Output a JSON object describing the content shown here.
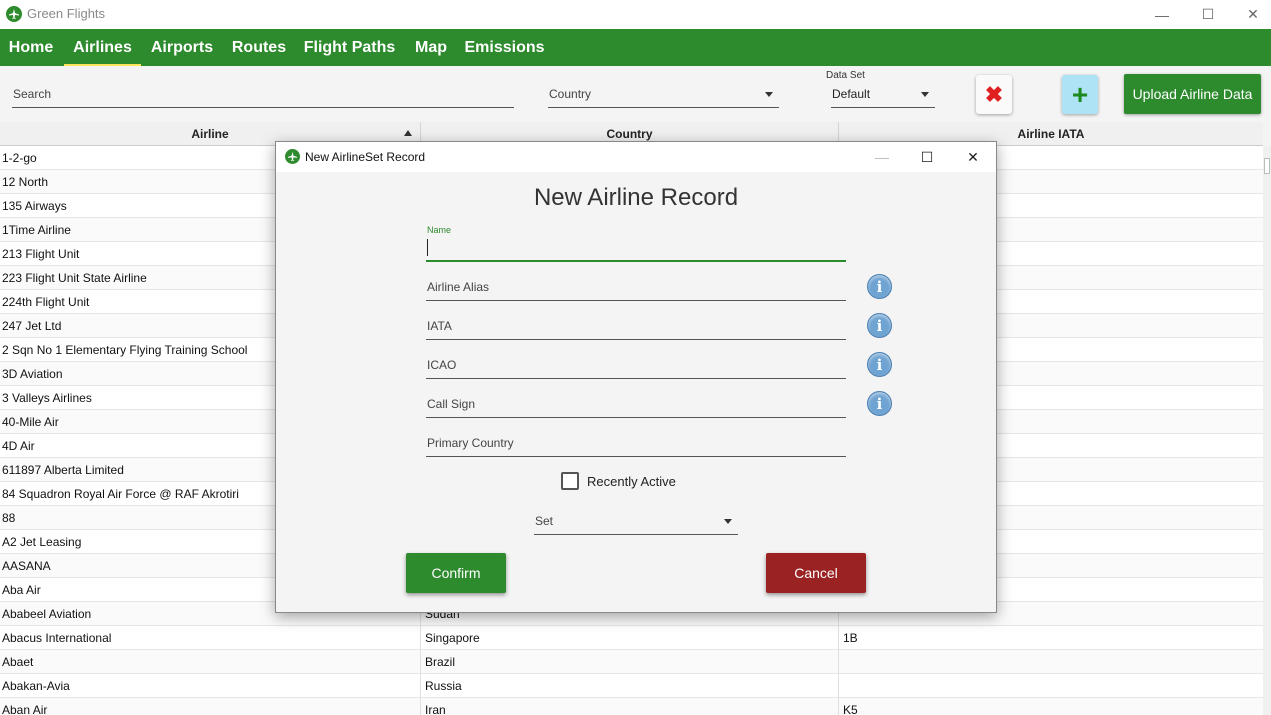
{
  "window": {
    "title": "Green Flights",
    "minimize": "—",
    "maximize": "☐",
    "close": "✕"
  },
  "nav": {
    "items": [
      {
        "label": "Home"
      },
      {
        "label": "Airlines",
        "active": true
      },
      {
        "label": "Airports"
      },
      {
        "label": "Routes"
      },
      {
        "label": "Flight Paths"
      },
      {
        "label": "Map"
      },
      {
        "label": "Emissions"
      }
    ]
  },
  "toolbar": {
    "search_label": "Search",
    "country_label": "Country",
    "dataset_label": "Data Set",
    "dataset_value": "Default",
    "delete_glyph": "✖",
    "add_glyph": "+",
    "upload_label": "Upload Airline Data"
  },
  "table": {
    "columns": [
      "Airline",
      "Country",
      "Airline IATA"
    ],
    "rows": [
      [
        "1-2-go",
        "",
        ""
      ],
      [
        "12 North",
        "",
        ""
      ],
      [
        "135 Airways",
        "",
        ""
      ],
      [
        "1Time Airline",
        "",
        ""
      ],
      [
        "213 Flight Unit",
        "",
        ""
      ],
      [
        "223 Flight Unit State Airline",
        "",
        ""
      ],
      [
        "224th Flight Unit",
        "",
        ""
      ],
      [
        "247 Jet Ltd",
        "",
        ""
      ],
      [
        "2 Sqn No 1 Elementary Flying Training School",
        "",
        ""
      ],
      [
        "3D Aviation",
        "",
        ""
      ],
      [
        "3 Valleys Airlines",
        "",
        ""
      ],
      [
        "40-Mile Air",
        "",
        ""
      ],
      [
        "4D Air",
        "",
        ""
      ],
      [
        "611897 Alberta Limited",
        "",
        ""
      ],
      [
        "84 Squadron Royal Air Force @ RAF Akrotiri",
        "",
        ""
      ],
      [
        "88",
        "",
        ""
      ],
      [
        "A2 Jet Leasing",
        "",
        ""
      ],
      [
        "AASANA",
        "",
        ""
      ],
      [
        "Aba Air",
        "",
        ""
      ],
      [
        "Ababeel Aviation",
        "Sudan",
        ""
      ],
      [
        "Abacus International",
        "Singapore",
        "1B"
      ],
      [
        "Abaet",
        "Brazil",
        ""
      ],
      [
        "Abakan-Avia",
        "Russia",
        ""
      ],
      [
        "Aban Air",
        "Iran",
        "K5"
      ]
    ]
  },
  "dialog": {
    "title": "New AirlineSet Record",
    "heading": "New Airline Record",
    "name_label": "Name",
    "name_value": "",
    "alias_label": "Airline Alias",
    "iata_label": "IATA",
    "icao_label": "ICAO",
    "callsign_label": "Call Sign",
    "country_label": "Primary Country",
    "info_glyph": "i",
    "recently_active_label": "Recently Active",
    "recently_active_checked": false,
    "set_label": "Set",
    "confirm_label": "Confirm",
    "cancel_label": "Cancel",
    "minimize": "—",
    "maximize": "☐",
    "close": "✕"
  },
  "colors": {
    "brand_green": "#2d8a2d",
    "active_underline": "#ffe45c",
    "cancel_red": "#9b2222",
    "info_blue": "#6fa3d2",
    "delete_red": "#e02020",
    "add_bg": "#aee3f6"
  }
}
